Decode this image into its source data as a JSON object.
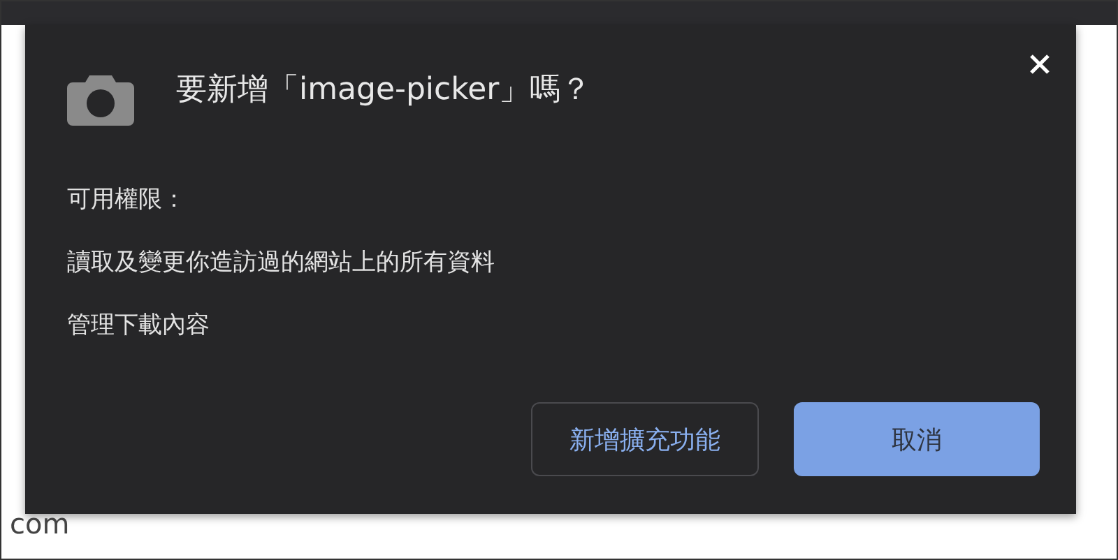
{
  "page": {
    "text_fragment": "com"
  },
  "dialog": {
    "title": "要新增「image-picker」嗎？",
    "permissions_heading": "可用權限：",
    "permissions": [
      "讀取及變更你造訪過的網站上的所有資料",
      "管理下載內容"
    ],
    "buttons": [
      {
        "label": "新增擴充功能",
        "kind": "outlined"
      },
      {
        "label": "取消",
        "kind": "filled"
      }
    ]
  }
}
